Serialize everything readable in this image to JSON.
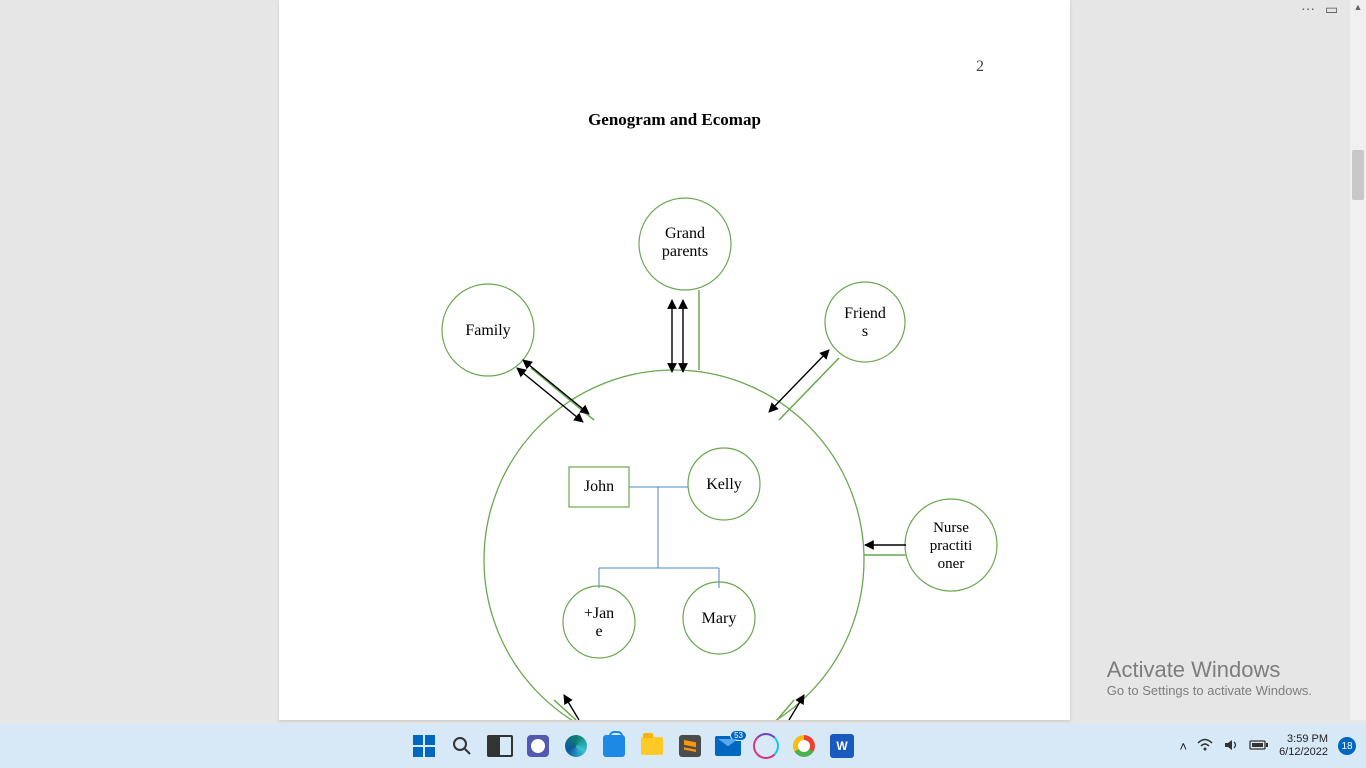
{
  "window": {
    "more": "···",
    "ribbon": "▭",
    "close": "✕"
  },
  "document": {
    "page_number": "2",
    "title": "Genogram and Ecomap"
  },
  "ecomap": {
    "outer_nodes": {
      "grandparents": "Grand parents",
      "family": "Family",
      "friends": "Friend s",
      "nurse_practitioner": "Nurse practiti oner"
    },
    "inner_nodes": {
      "john": "John",
      "kelly": "Kelly",
      "jane": "+Jan e",
      "mary": "Mary"
    }
  },
  "watermark": {
    "title": "Activate Windows",
    "sub": "Go to Settings to activate Windows."
  },
  "taskbar": {
    "mail_badge": "53",
    "time": "3:59 PM",
    "date": "6/12/2022",
    "notif_count": "18"
  }
}
